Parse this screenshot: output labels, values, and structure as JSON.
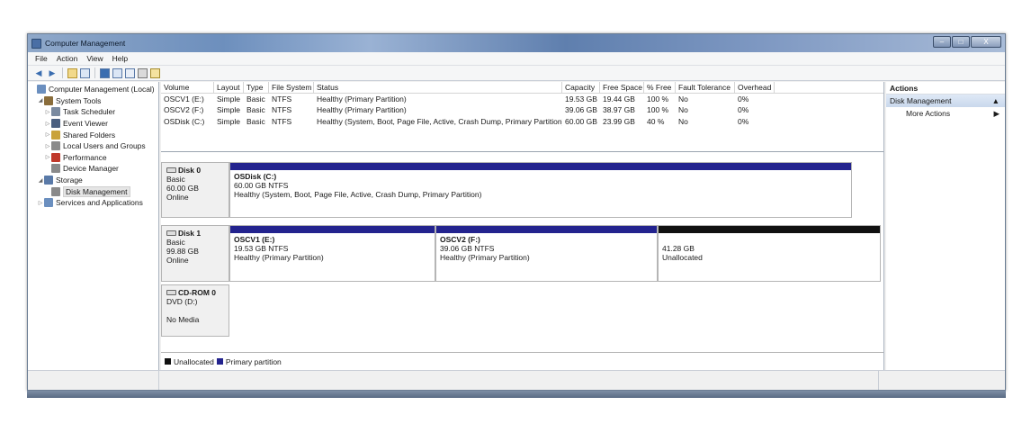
{
  "window": {
    "title": "Computer Management",
    "controls": [
      "–",
      "□",
      "X"
    ]
  },
  "menu": [
    "File",
    "Action",
    "View",
    "Help"
  ],
  "tree": [
    {
      "label": "Computer Management (Local)",
      "indent": 0,
      "arrow": "",
      "icon_color": "#6b8fbf",
      "selected": false
    },
    {
      "label": "System Tools",
      "indent": 1,
      "arrow": "◢",
      "icon_color": "#8a6d3b",
      "selected": false
    },
    {
      "label": "Task Scheduler",
      "indent": 2,
      "arrow": "▷",
      "icon_color": "#7a8aa0",
      "selected": false
    },
    {
      "label": "Event Viewer",
      "indent": 2,
      "arrow": "▷",
      "icon_color": "#4a5f80",
      "selected": false
    },
    {
      "label": "Shared Folders",
      "indent": 2,
      "arrow": "▷",
      "icon_color": "#c9a23a",
      "selected": false
    },
    {
      "label": "Local Users and Groups",
      "indent": 2,
      "arrow": "▷",
      "icon_color": "#8a8a8a",
      "selected": false
    },
    {
      "label": "Performance",
      "indent": 2,
      "arrow": "▷",
      "icon_color": "#c0392b",
      "selected": false
    },
    {
      "label": "Device Manager",
      "indent": 2,
      "arrow": "",
      "icon_color": "#8a8a8a",
      "selected": false
    },
    {
      "label": "Storage",
      "indent": 1,
      "arrow": "◢",
      "icon_color": "#5a7aa8",
      "selected": false
    },
    {
      "label": "Disk Management",
      "indent": 2,
      "arrow": "",
      "icon_color": "#8a8a8a",
      "selected": true
    },
    {
      "label": "Services and Applications",
      "indent": 1,
      "arrow": "▷",
      "icon_color": "#6b8fbf",
      "selected": false
    }
  ],
  "volume_table": {
    "headers": [
      "Volume",
      "Layout",
      "Type",
      "File System",
      "Status",
      "Capacity",
      "Free Space",
      "% Free",
      "Fault Tolerance",
      "Overhead"
    ],
    "rows": [
      [
        "OSCV1 (E:)",
        "Simple",
        "Basic",
        "NTFS",
        "Healthy (Primary Partition)",
        "19.53 GB",
        "19.44 GB",
        "100 %",
        "No",
        "0%"
      ],
      [
        "OSCV2 (F:)",
        "Simple",
        "Basic",
        "NTFS",
        "Healthy (Primary Partition)",
        "39.06 GB",
        "38.97 GB",
        "100 %",
        "No",
        "0%"
      ],
      [
        "OSDisk (C:)",
        "Simple",
        "Basic",
        "NTFS",
        "Healthy (System, Boot, Page File, Active, Crash Dump, Primary Partition)",
        "60.00 GB",
        "23.99 GB",
        "40 %",
        "No",
        "0%"
      ]
    ]
  },
  "disks": [
    {
      "name": "Disk 0",
      "type": "Basic",
      "size": "60.00 GB",
      "state": "Online",
      "partitions": [
        {
          "name": "OSDisk  (C:)",
          "size": "60.00 GB NTFS",
          "status": "Healthy (System, Boot, Page File, Active, Crash Dump, Primary Partition)",
          "kind": "primary"
        }
      ]
    },
    {
      "name": "Disk 1",
      "type": "Basic",
      "size": "99.88 GB",
      "state": "Online",
      "partitions": [
        {
          "name": "OSCV1  (E:)",
          "size": "19.53 GB NTFS",
          "status": "Healthy (Primary Partition)",
          "kind": "primary"
        },
        {
          "name": "OSCV2  (F:)",
          "size": "39.06 GB NTFS",
          "status": "Healthy (Primary Partition)",
          "kind": "primary"
        },
        {
          "name": "",
          "size": "41.28 GB",
          "status": "Unallocated",
          "kind": "unallocated"
        }
      ]
    },
    {
      "name": "CD-ROM 0",
      "type": "DVD (D:)",
      "size": "",
      "state": "No Media",
      "partitions": []
    }
  ],
  "legend": [
    {
      "label": "Unallocated",
      "color": "#111111"
    },
    {
      "label": "Primary partition",
      "color": "#23238e"
    }
  ],
  "actions": {
    "header": "Actions",
    "section": "Disk Management",
    "section_arrow": "▲",
    "items": [
      {
        "label": "More Actions",
        "arrow": "▶"
      }
    ]
  }
}
